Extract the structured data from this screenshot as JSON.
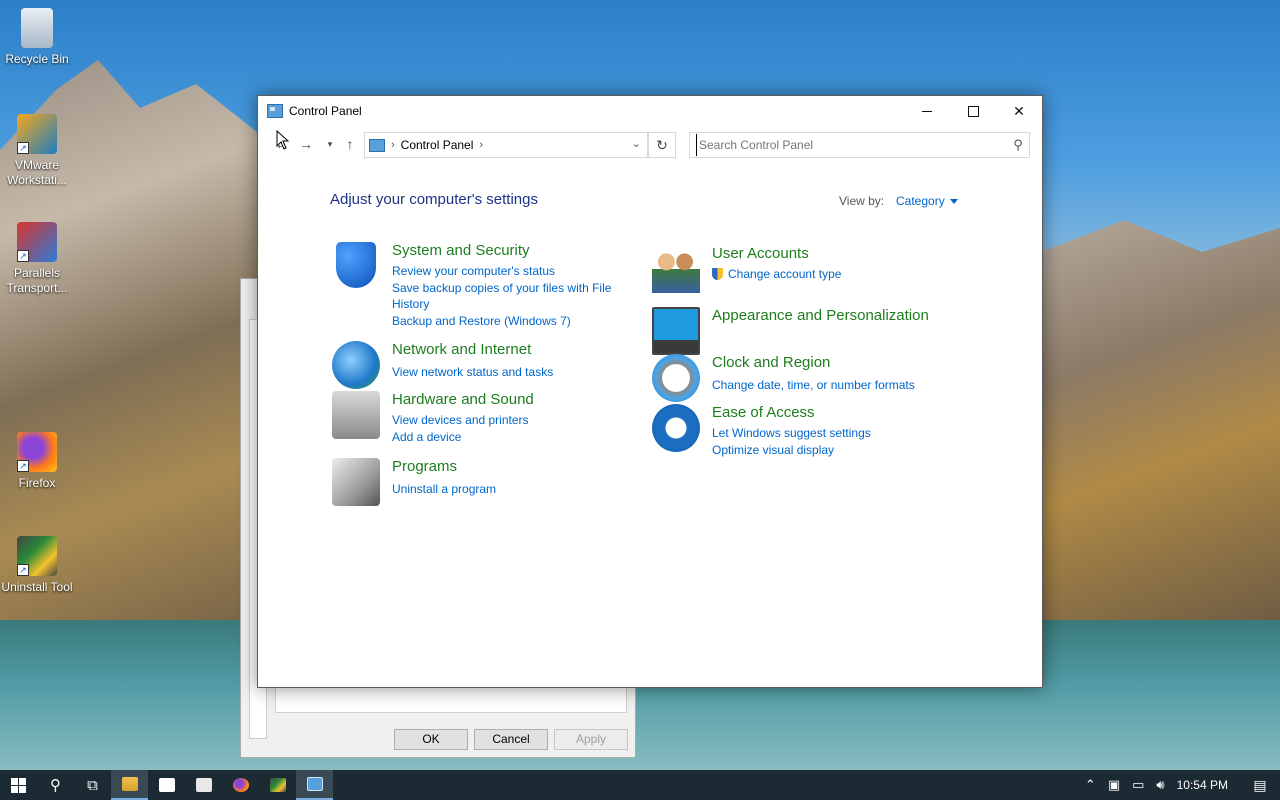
{
  "desktop": {
    "icons": [
      {
        "label": "Recycle Bin",
        "icon": "recycle-bin-icon"
      },
      {
        "label": "VMware Workstati...",
        "icon": "vmware-icon"
      },
      {
        "label": "Parallels Transport...",
        "icon": "parallels-icon"
      },
      {
        "label": "Firefox",
        "icon": "firefox-icon"
      },
      {
        "label": "Uninstall Tool",
        "icon": "uninstall-tool-icon"
      }
    ]
  },
  "background_dialog": {
    "ok_label": "OK",
    "cancel_label": "Cancel",
    "apply_label": "Apply"
  },
  "window": {
    "title": "Control Panel",
    "address": {
      "crumb": "Control Panel"
    },
    "search": {
      "placeholder": "Search Control Panel"
    },
    "heading": "Adjust your computer's settings",
    "view_by_label": "View by:",
    "view_by_value": "Category",
    "categories_left": [
      {
        "title": "System and Security",
        "icon": "shield-icon",
        "links": [
          "Review your computer's status",
          "Save backup copies of your files with File History",
          "Backup and Restore (Windows 7)"
        ]
      },
      {
        "title": "Network and Internet",
        "icon": "network-globe-icon",
        "links": [
          "View network status and tasks"
        ]
      },
      {
        "title": "Hardware and Sound",
        "icon": "printer-speaker-icon",
        "links": [
          "View devices and printers",
          "Add a device"
        ]
      },
      {
        "title": "Programs",
        "icon": "programs-disc-icon",
        "links": [
          "Uninstall a program"
        ]
      }
    ],
    "categories_right": [
      {
        "title": "User Accounts",
        "icon": "users-icon",
        "links": [
          "Change account type"
        ]
      },
      {
        "title": "Appearance and Personalization",
        "icon": "monitor-palette-icon",
        "links": []
      },
      {
        "title": "Clock and Region",
        "icon": "clock-globe-icon",
        "links": [
          "Change date, time, or number formats"
        ]
      },
      {
        "title": "Ease of Access",
        "icon": "ease-of-access-icon",
        "links": [
          "Let Windows suggest settings",
          "Optimize visual display"
        ]
      }
    ]
  },
  "taskbar": {
    "clock": "10:54 PM"
  },
  "colors": {
    "category_title": "#1e7d1e",
    "link": "#0066cc",
    "heading": "#1e3287",
    "taskbar": "#1c2a33"
  }
}
